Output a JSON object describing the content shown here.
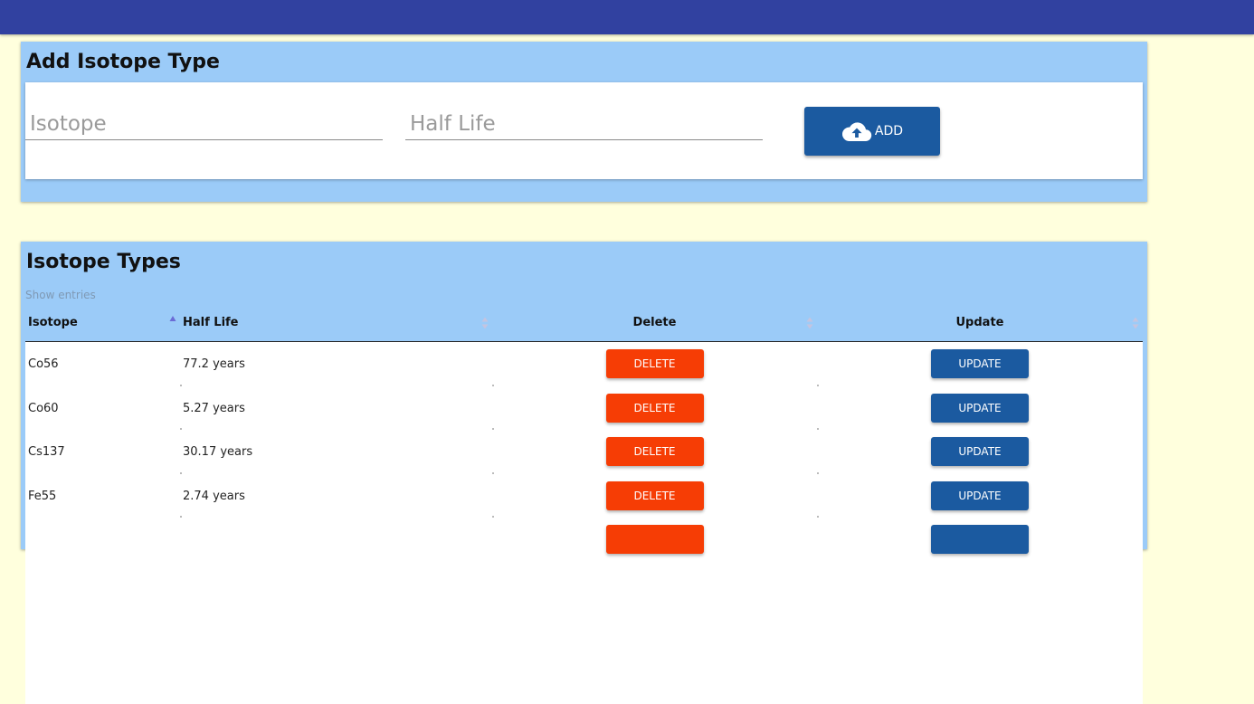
{
  "add_panel": {
    "title": "Add Isotope Type",
    "isotope_placeholder": "Isotope",
    "isotope_value": "",
    "halflife_placeholder": "Half Life",
    "halflife_value": "",
    "add_label": "ADD",
    "add_icon": "cloud-upload-icon"
  },
  "list_panel": {
    "title": "Isotope Types",
    "show_entries": "Show entries",
    "columns": [
      "Isotope",
      "Half Life",
      "Delete",
      "Update"
    ],
    "rows": [
      {
        "isotope": "Co56",
        "half_life": "77.2 years",
        "delete": "DELETE",
        "update": "UPDATE"
      },
      {
        "isotope": "Co60",
        "half_life": "5.27 years",
        "delete": "DELETE",
        "update": "UPDATE"
      },
      {
        "isotope": "Cs137",
        "half_life": "30.17 years",
        "delete": "DELETE",
        "update": "UPDATE"
      },
      {
        "isotope": "Fe55",
        "half_life": "2.74 years",
        "delete": "DELETE",
        "update": "UPDATE"
      },
      {
        "isotope": "",
        "half_life": "",
        "delete": "",
        "update": ""
      }
    ]
  },
  "colors": {
    "topbar": "#3141a0",
    "page_background": "#ffffdd",
    "panel": "#9bcbf8",
    "primary_button": "#1b5aa0",
    "delete_button": "#f63d05"
  }
}
